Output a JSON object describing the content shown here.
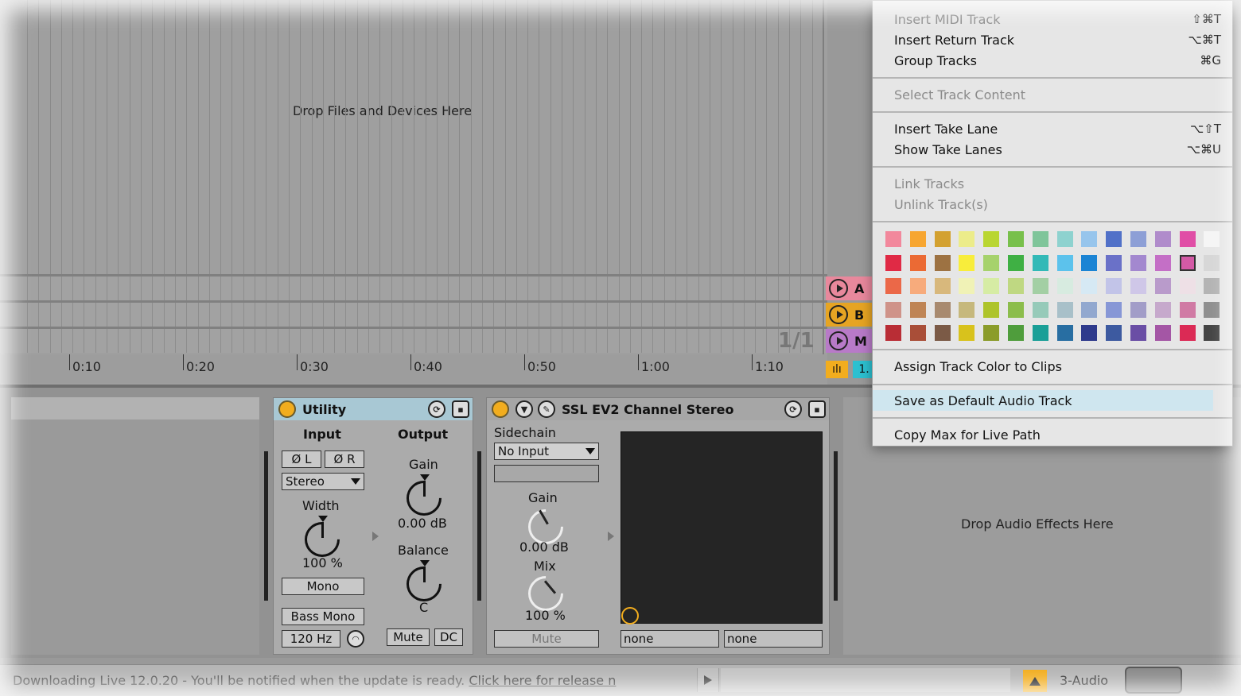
{
  "arrangement": {
    "drop_hint": "Drop Files and Devices Here",
    "page_indicator": "1/1",
    "ruler_labels": [
      "0:10",
      "0:20",
      "0:30",
      "0:40",
      "0:50",
      "1:00",
      "1:10"
    ],
    "return_tracks": [
      {
        "label": "A",
        "color": "#e8889c"
      },
      {
        "label": "B",
        "color": "#e6a423"
      },
      {
        "label": "M",
        "color": "#b87ac8"
      }
    ],
    "clip_label": "1."
  },
  "utility": {
    "title": "Utility",
    "input_label": "Input",
    "output_label": "Output",
    "phase_left": "Ø L",
    "phase_right": "Ø R",
    "channel_mode": "Stereo",
    "width_label": "Width",
    "width_value": "100 %",
    "mono_label": "Mono",
    "bass_mono_label": "Bass Mono",
    "bass_freq": "120 Hz",
    "gain_label": "Gain",
    "gain_value": "0.00 dB",
    "balance_label": "Balance",
    "balance_value": "C",
    "mute_label": "Mute",
    "dc_label": "DC"
  },
  "ssl": {
    "title": "SSL EV2 Channel Stereo",
    "sidechain_label": "Sidechain",
    "sidechain_value": "No Input",
    "gain_label": "Gain",
    "gain_value": "0.00 dB",
    "mix_label": "Mix",
    "mix_value": "100 %",
    "mute_label": "Mute",
    "param_left": "none",
    "param_right": "none"
  },
  "fx_drop_hint": "Drop Audio Effects Here",
  "status": {
    "message": "Downloading Live 12.0.20 - You'll be notified when the update is ready.",
    "link": "Click here for release n",
    "track_name": "3-Audio"
  },
  "menu": {
    "items": [
      {
        "label": "Insert MIDI Track",
        "shortcut": "⇧⌘T",
        "disabled": true
      },
      {
        "label": "Insert Return Track",
        "shortcut": "⌥⌘T",
        "disabled": false
      },
      {
        "label": "Group Tracks",
        "shortcut": "⌘G",
        "disabled": false
      },
      {
        "label": "Select Track Content",
        "shortcut": "",
        "disabled": true
      },
      {
        "label": "Insert Take Lane",
        "shortcut": "⌥⇧T",
        "disabled": false
      },
      {
        "label": "Show Take Lanes",
        "shortcut": "⌥⌘U",
        "disabled": false
      },
      {
        "label": "Link Tracks",
        "shortcut": "",
        "disabled": true
      },
      {
        "label": "Unlink Track(s)",
        "shortcut": "",
        "disabled": true
      },
      {
        "label": "Assign Track Color to Clips",
        "shortcut": "",
        "disabled": false
      },
      {
        "label": "Save as Default Audio Track",
        "shortcut": "",
        "disabled": false,
        "highlighted": true
      },
      {
        "label": "Copy Max for Live Path",
        "shortcut": "",
        "disabled": false
      }
    ],
    "palette": [
      [
        "#f2889c",
        "#f7a630",
        "#d3a130",
        "#ecec8a",
        "#b9d632",
        "#78c04b",
        "#7fc59a",
        "#8ed2cf",
        "#97c5ec",
        "#5171c8",
        "#8d9fd6",
        "#b08ccb",
        "#e04ea6",
        "#f5f5f5"
      ],
      [
        "#e02a45",
        "#eb6a34",
        "#9d7242",
        "#f8ed3b",
        "#a6d26c",
        "#3fb044",
        "#32b9b7",
        "#5cc2ec",
        "#1b84d4",
        "#6a71c8",
        "#a388cf",
        "#c46fc6",
        "#d45aa6",
        "#d7d7d7"
      ],
      [
        "#eb6848",
        "#f7ab7c",
        "#d8b87c",
        "#f0f2b6",
        "#d6eca4",
        "#bfd882",
        "#a3cfa4",
        "#d7ebe0",
        "#d6e9f4",
        "#c2c4e8",
        "#cfc7e8",
        "#b99bcb",
        "#eee0e6",
        "#b4b4b4"
      ],
      [
        "#cf9389",
        "#bf8555",
        "#a88a6f",
        "#c6b87c",
        "#aec42a",
        "#8cbd4c",
        "#96cab9",
        "#a8c0c9",
        "#92a8cf",
        "#8797d6",
        "#a29dc8",
        "#c6a9cc",
        "#d07aa4",
        "#8f8f8f"
      ],
      [
        "#b92d35",
        "#a94e38",
        "#7b5a46",
        "#d8c21c",
        "#8b9c2a",
        "#4f9d3c",
        "#1a9f97",
        "#286ea2",
        "#2e3a8c",
        "#3d5aa0",
        "#6a4ea5",
        "#a456a5",
        "#db2a55",
        "#444444"
      ]
    ]
  }
}
